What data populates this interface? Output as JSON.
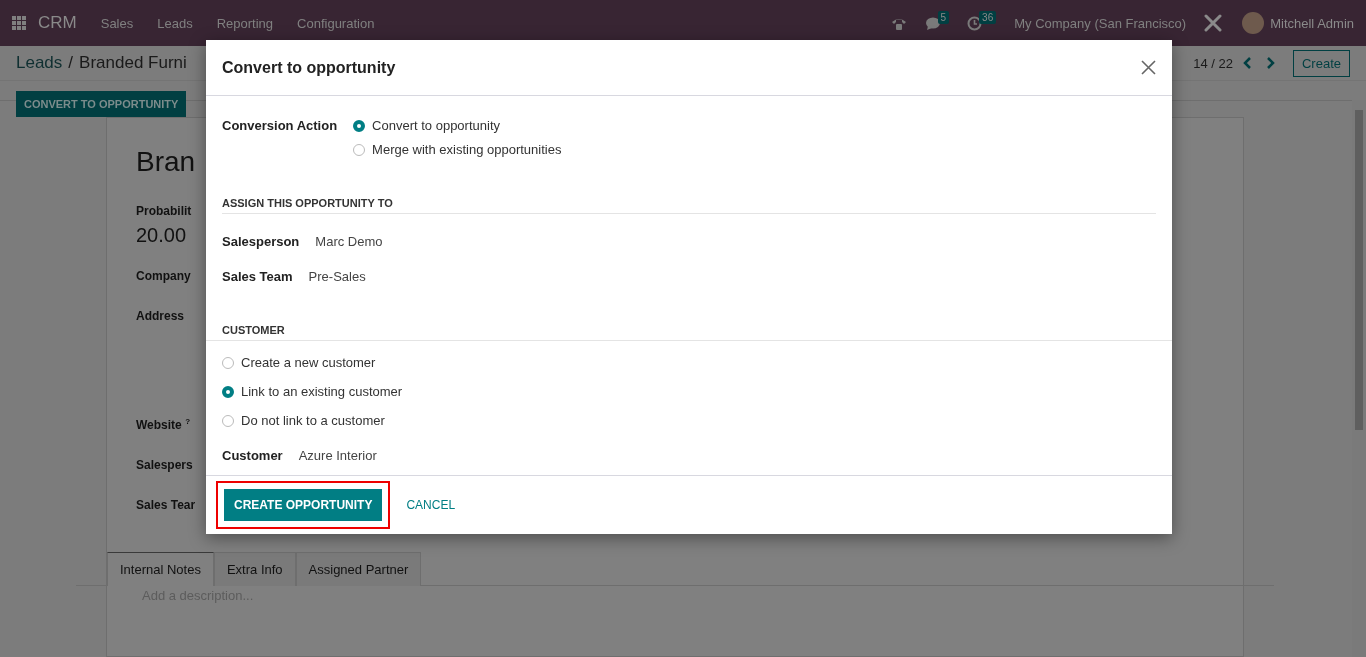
{
  "navbar": {
    "app_name": "CRM",
    "menu": [
      "Sales",
      "Leads",
      "Reporting",
      "Configuration"
    ],
    "chat_count": "5",
    "activity_count": "36",
    "company": "My Company (San Francisco)",
    "user": "Mitchell Admin"
  },
  "breadcrumb": {
    "items": [
      "Leads",
      "Branded Furni"
    ],
    "separator": "/"
  },
  "action_button": "CONVERT TO OPPORTUNITY",
  "pager": "14 / 22",
  "create_button": "Create",
  "form": {
    "title": "Bran",
    "probability_label": "Probabilit",
    "probability_value": "20.00",
    "labels": [
      {
        "text": "Company",
        "kind": "field"
      },
      {
        "text": "Address",
        "kind": "address"
      },
      {
        "text": "Website $^{?}$",
        "kind": "field"
      },
      {
        "text": "Salespers",
        "kind": "field"
      },
      {
        "text": "Sales Tear",
        "kind": "field"
      }
    ],
    "tabs": [
      {
        "label": "Internal Notes",
        "selected": true
      },
      {
        "label": "Extra Info",
        "selected": false
      },
      {
        "label": "Assigned Partner",
        "selected": false
      }
    ],
    "description_placeholder": "Add a description..."
  },
  "dialog": {
    "title": "Convert to opportunity",
    "conversion_action": {
      "label": "Conversion Action",
      "options": [
        {
          "label": "Convert to opportunity",
          "selected": true
        },
        {
          "label": "Merge with existing opportunities",
          "selected": false
        }
      ]
    },
    "assign_heading": "ASSIGN THIS OPPORTUNITY TO",
    "assign_fields": [
      {
        "label": "Salesperson",
        "value": "Marc Demo"
      },
      {
        "label": "Sales Team",
        "value": "Pre-Sales"
      }
    ],
    "customer_heading": "CUSTOMER",
    "customer_options": [
      {
        "label": "Create a new customer",
        "selected": false
      },
      {
        "label": "Link to an existing customer",
        "selected": true
      },
      {
        "label": "Do not link to a customer",
        "selected": false
      }
    ],
    "customer_field": {
      "label": "Customer",
      "value": "Azure Interior"
    },
    "buttons": [
      {
        "label": "CREATE OPPORTUNITY",
        "kind": "primary",
        "highlighted": true
      },
      {
        "label": "CANCEL",
        "kind": "link",
        "highlighted": false
      }
    ]
  }
}
